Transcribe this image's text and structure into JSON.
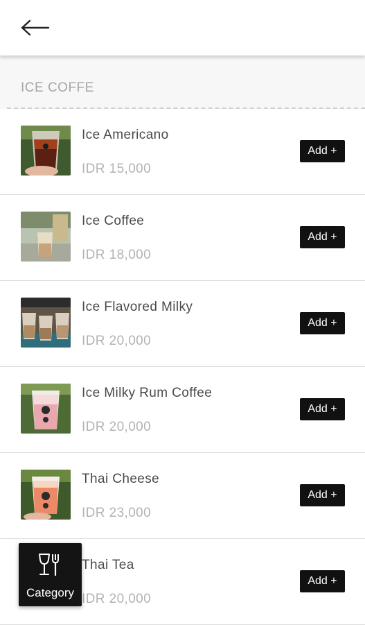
{
  "header": {
    "back_icon": "arrow-left-icon"
  },
  "section": {
    "title": "ICE COFFE"
  },
  "items": [
    {
      "name": "Ice Americano",
      "price": "IDR 15,000",
      "add_label": "Add +"
    },
    {
      "name": "Ice Coffee",
      "price": "IDR 18,000",
      "add_label": "Add +"
    },
    {
      "name": "Ice Flavored Milky",
      "price": "IDR 20,000",
      "add_label": "Add +"
    },
    {
      "name": "Ice Milky Rum Coffee",
      "price": "IDR 20,000",
      "add_label": "Add +"
    },
    {
      "name": "Thai Cheese",
      "price": "IDR 23,000",
      "add_label": "Add +"
    },
    {
      "name": "Thai Tea",
      "price": "IDR 20,000",
      "add_label": "Add +"
    }
  ],
  "category_button": {
    "label": "Category",
    "icon": "glass-fork-icon"
  },
  "colors": {
    "button_bg": "#111111",
    "button_text": "#ffffff",
    "price_text": "#b3b3b3",
    "section_title": "#a6a6a6"
  }
}
